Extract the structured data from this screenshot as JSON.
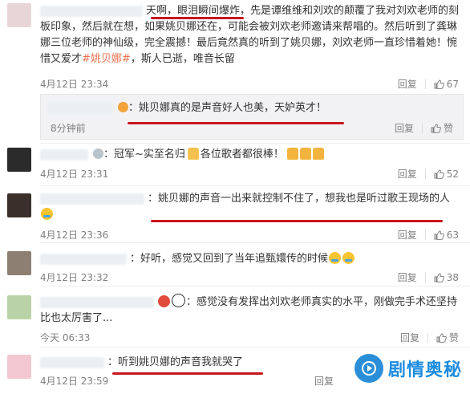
{
  "comments": [
    {
      "text_before": "天啊，眼泪瞬间爆炸，先是谭维维和刘欢的颠覆了我对刘欢老师的刻板印象，然后就在想，如果姚贝娜还在，可能会被刘欢老师邀请来帮唱的。然后听到了龚琳娜三位老师的神仙级，完全震撼！最后竟然真的听到了姚贝娜，刘欢老师一直珍惜着她！惋惜又爱才",
      "hashtag": "#姚贝娜#",
      "text_after": "，斯人已逝，唯音长留",
      "time": "4月12日 23:34",
      "reply": "回复",
      "likes": "67"
    },
    {
      "text": "姚贝娜真的是声音好人也美，天妒英才！",
      "time": "8分钟前",
      "reply": "回复",
      "likes": "赞"
    },
    {
      "text": "冠军~实至名归",
      "text2": "各位歌者都很棒！",
      "time": "4月12日 23:31",
      "reply": "回复",
      "likes": "52"
    },
    {
      "text": "姚贝娜的声音一出来就控制不住了，想我也是听过歌王现场的人",
      "time": "4月12日 23:36",
      "reply": "回复",
      "likes": "63"
    },
    {
      "text": "好听，感觉又回到了当年追甄嬛传的时候",
      "time": "4月12日 23:32",
      "reply": "回复",
      "likes": "38"
    },
    {
      "text": "感觉没有发挥出刘欢老师真实的水平，刚做完手术还坚持比也太厉害了...",
      "time": "今天 06:33",
      "reply": "回复",
      "likes": "赞"
    },
    {
      "text": "听到姚贝娜的声音我就哭了",
      "time": "4月12日 23:59",
      "reply": "回复",
      "likes": ""
    }
  ],
  "watermark": {
    "text": "剧情奥秘"
  },
  "colors": {
    "accent": "#eb7350",
    "underline": "#c8161d",
    "watermark": "#1d8ce0"
  }
}
